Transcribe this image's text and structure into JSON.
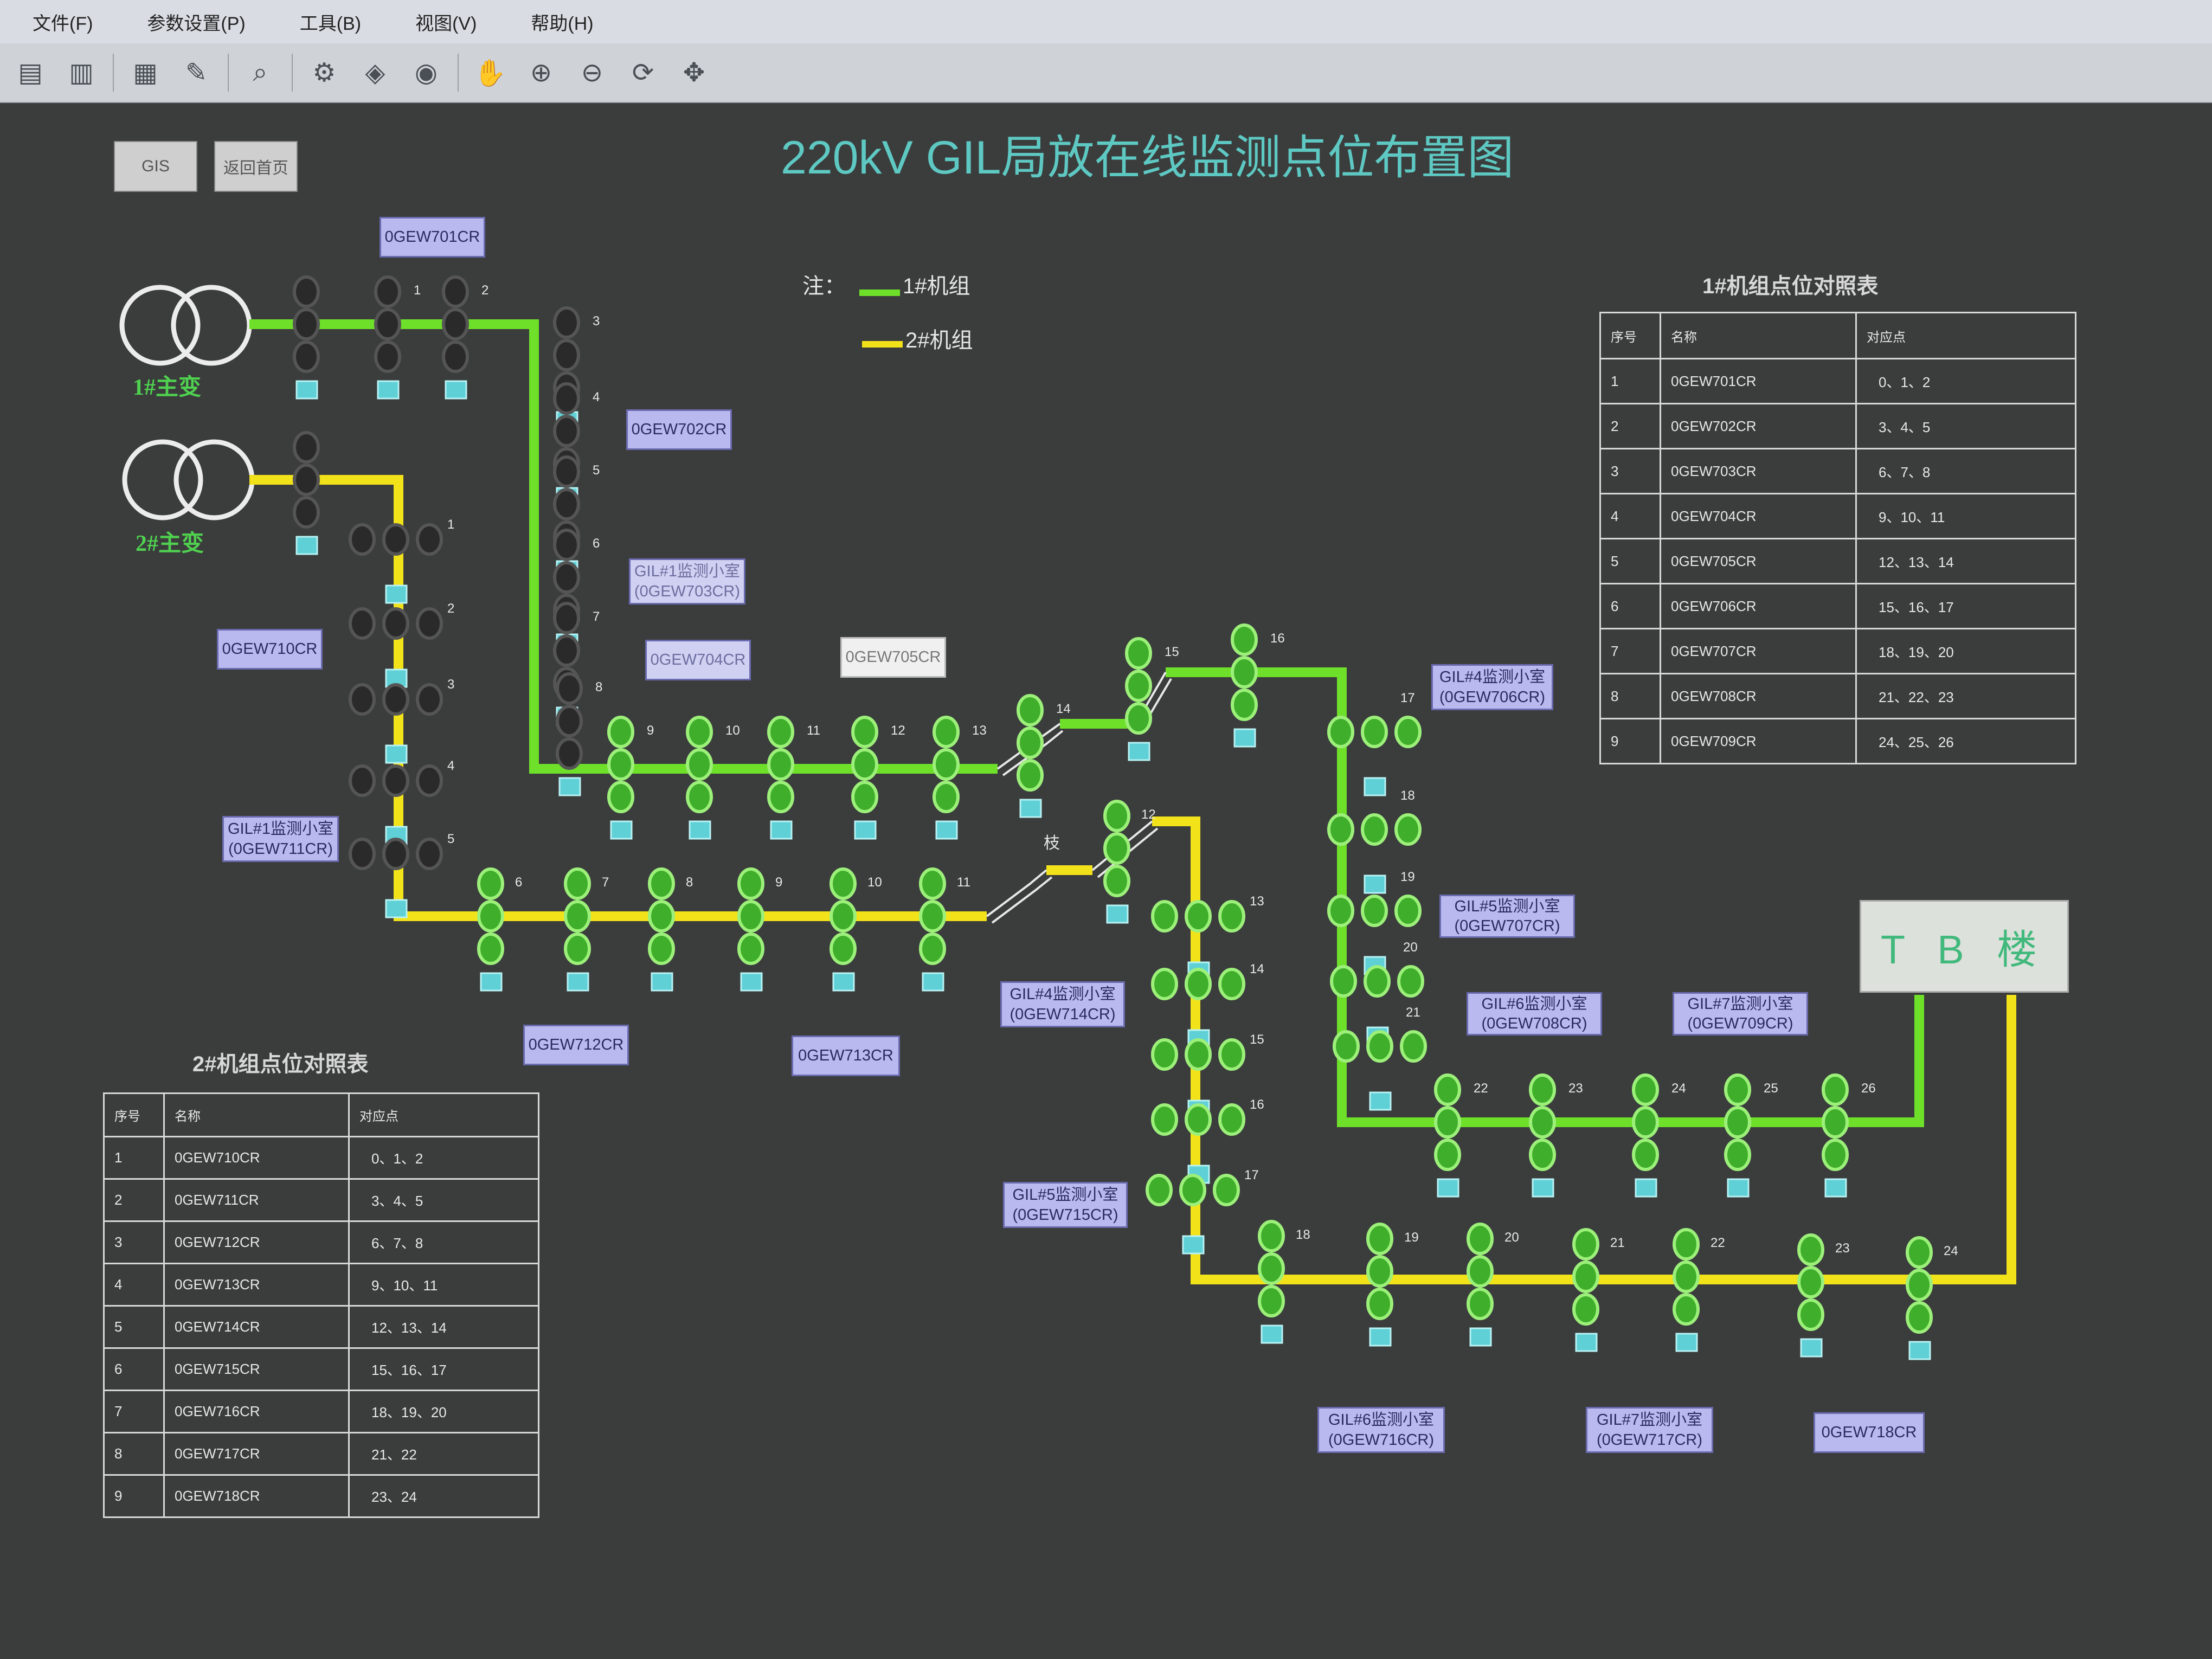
{
  "menu": [
    "文件(F)",
    "参数设置(P)",
    "工具(B)",
    "视图(V)",
    "帮助(H)"
  ],
  "toolbar_icons": [
    "open-icon",
    "save-icon",
    "config-icon",
    "tools-icon",
    "search-icon",
    "settings-icon",
    "layers-icon",
    "alarm-icon",
    "hand-pan-icon",
    "zoom-in-icon",
    "zoom-out-icon",
    "refresh-icon",
    "fit-view-icon"
  ],
  "nav": {
    "gis": "GIS",
    "home": "返回首页"
  },
  "title": "220kV GIL局放在线监测点位布置图",
  "legend": {
    "prefix": "注：",
    "unit1": "1#机组",
    "unit2": "2#机组"
  },
  "colors": {
    "unit1_line": "#6ee02a",
    "unit2_line": "#f2e21a",
    "title": "#5ec8c2"
  },
  "transformers": {
    "t1": "1#主变",
    "t2": "2#主变"
  },
  "tb_building": "T B 楼",
  "branch_char": "枝",
  "device_labels": {
    "w701": "0GEW701CR",
    "w702": "0GEW702CR",
    "w703": [
      "GIL#1监测小室",
      "(0GEW703CR)"
    ],
    "w704": "0GEW704CR",
    "w705": "0GEW705CR",
    "w706": [
      "GIL#4监测小室",
      "(0GEW706CR)"
    ],
    "w707": [
      "GIL#5监测小室",
      "(0GEW707CR)"
    ],
    "w708": [
      "GIL#6监测小室",
      "(0GEW708CR)"
    ],
    "w709": [
      "GIL#7监测小室",
      "(0GEW709CR)"
    ],
    "w710": "0GEW710CR",
    "w711": [
      "GIL#1监测小室",
      "(0GEW711CR)"
    ],
    "w712": "0GEW712CR",
    "w713": "0GEW713CR",
    "w714": [
      "GIL#4监测小室",
      "(0GEW714CR)"
    ],
    "w715": [
      "GIL#5监测小室",
      "(0GEW715CR)"
    ],
    "w716": [
      "GIL#6监测小室",
      "(0GEW716CR)"
    ],
    "w717": [
      "GIL#7监测小室",
      "(0GEW717CR)"
    ],
    "w718": "0GEW718CR"
  },
  "unit1_points": [
    "1",
    "2",
    "3",
    "4",
    "5",
    "6",
    "7",
    "8",
    "9",
    "10",
    "11",
    "12",
    "13",
    "14",
    "15",
    "16",
    "17",
    "18",
    "19",
    "20",
    "21",
    "22",
    "23",
    "24",
    "25",
    "26"
  ],
  "unit2_points": [
    "1",
    "2",
    "3",
    "4",
    "5",
    "6",
    "7",
    "8",
    "9",
    "10",
    "11",
    "12",
    "13",
    "14",
    "15",
    "16",
    "17",
    "18",
    "19",
    "20",
    "21",
    "22",
    "23",
    "24"
  ],
  "table1": {
    "title": "1#机组点位对照表",
    "headers": [
      "序号",
      "名称",
      "对应点"
    ],
    "rows": [
      [
        "1",
        "0GEW701CR",
        "0、1、2"
      ],
      [
        "2",
        "0GEW702CR",
        "3、4、5"
      ],
      [
        "3",
        "0GEW703CR",
        "6、7、8"
      ],
      [
        "4",
        "0GEW704CR",
        "9、10、11"
      ],
      [
        "5",
        "0GEW705CR",
        "12、13、14"
      ],
      [
        "6",
        "0GEW706CR",
        "15、16、17"
      ],
      [
        "7",
        "0GEW707CR",
        "18、19、20"
      ],
      [
        "8",
        "0GEW708CR",
        "21、22、23"
      ],
      [
        "9",
        "0GEW709CR",
        "24、25、26"
      ]
    ]
  },
  "table2": {
    "title": "2#机组点位对照表",
    "headers": [
      "序号",
      "名称",
      "对应点"
    ],
    "rows": [
      [
        "1",
        "0GEW710CR",
        "0、1、2"
      ],
      [
        "2",
        "0GEW711CR",
        "3、4、5"
      ],
      [
        "3",
        "0GEW712CR",
        "6、7、8"
      ],
      [
        "4",
        "0GEW713CR",
        "9、10、11"
      ],
      [
        "5",
        "0GEW714CR",
        "12、13、14"
      ],
      [
        "6",
        "0GEW715CR",
        "15、16、17"
      ],
      [
        "7",
        "0GEW716CR",
        "18、19、20"
      ],
      [
        "8",
        "0GEW717CR",
        "21、22"
      ],
      [
        "9",
        "0GEW718CR",
        "23、24"
      ]
    ]
  }
}
